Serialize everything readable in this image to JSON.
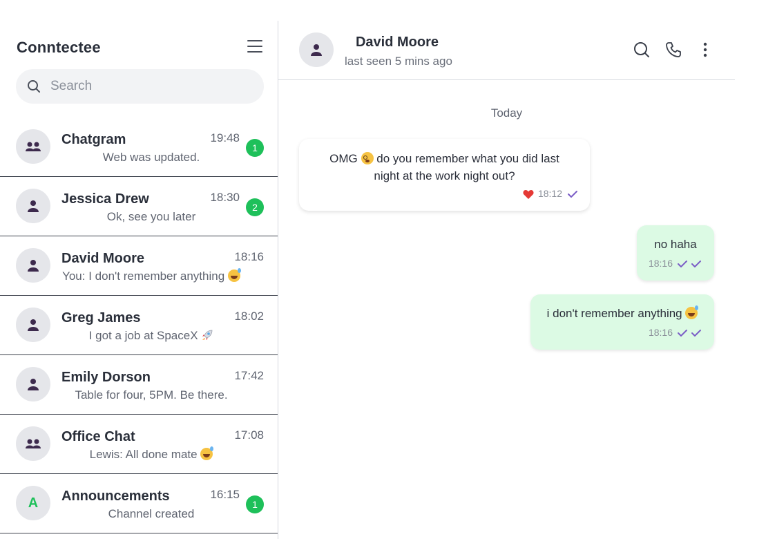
{
  "sidebar": {
    "app_title": "Conntectee",
    "search_placeholder": "Search",
    "chats": [
      {
        "name": "Chatgram",
        "time": "19:48",
        "preview": "Web was updated.",
        "badge": "1",
        "avatar": "group-icon"
      },
      {
        "name": "Jessica Drew",
        "time": "18:30",
        "preview": "Ok, see you later",
        "badge": "2",
        "avatar": "user-icon"
      },
      {
        "name": "David Moore",
        "time": "18:16",
        "preview": "You: I don't remember anything",
        "emoji": "grinning-sweat-emoji",
        "avatar": "user-icon"
      },
      {
        "name": "Greg James",
        "time": "18:02",
        "preview": "I got a job at SpaceX",
        "emoji": "rocket-emoji",
        "avatar": "user-icon"
      },
      {
        "name": "Emily Dorson",
        "time": "17:42",
        "preview": "Table for four, 5PM. Be there.",
        "avatar": "user-icon"
      },
      {
        "name": "Office Chat",
        "time": "17:08",
        "preview": "Lewis: All done mate",
        "emoji": "grinning-sweat-emoji",
        "avatar": "group-icon"
      },
      {
        "name": "Announcements",
        "time": "16:15",
        "preview": "Channel created",
        "badge": "1",
        "avatar_letter": "A"
      }
    ]
  },
  "conversation": {
    "contact_name": "David Moore",
    "status": "last seen 5 mins ago",
    "date_separator": "Today",
    "messages": [
      {
        "direction": "incoming",
        "text_before": "OMG",
        "emoji": "flushed-emoji",
        "text_after": "do you remember what you did last night at the work night out?",
        "reaction": "heart",
        "time": "18:12",
        "ticks": "single"
      },
      {
        "direction": "outgoing",
        "text": "no haha",
        "time": "18:16",
        "ticks": "double"
      },
      {
        "direction": "outgoing",
        "text": "i don't remember anything",
        "emoji": "grinning-sweat-emoji",
        "time": "18:16",
        "ticks": "double"
      }
    ]
  },
  "colors": {
    "accent_green": "#1ec05a",
    "tick_purple": "#7a5cc6",
    "outgoing_bubble": "#dcfae4",
    "avatar_icon": "#3d2a4d",
    "heart": "#e53935"
  }
}
